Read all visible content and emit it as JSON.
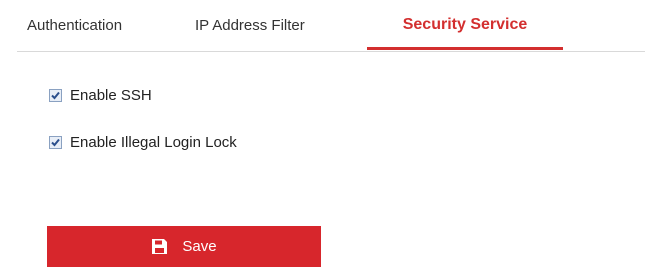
{
  "tabs": [
    {
      "label": "Authentication"
    },
    {
      "label": "IP Address Filter"
    },
    {
      "label": "Security Service",
      "active": true
    }
  ],
  "options": [
    {
      "label": "Enable SSH",
      "checked": true
    },
    {
      "label": "Enable Illegal Login Lock",
      "checked": true
    }
  ],
  "save_button": {
    "label": "Save",
    "icon": "floppy-disk-icon"
  },
  "colors": {
    "accent": "#d32f2f",
    "button": "#d7262c",
    "divider": "#d9d9d9"
  }
}
